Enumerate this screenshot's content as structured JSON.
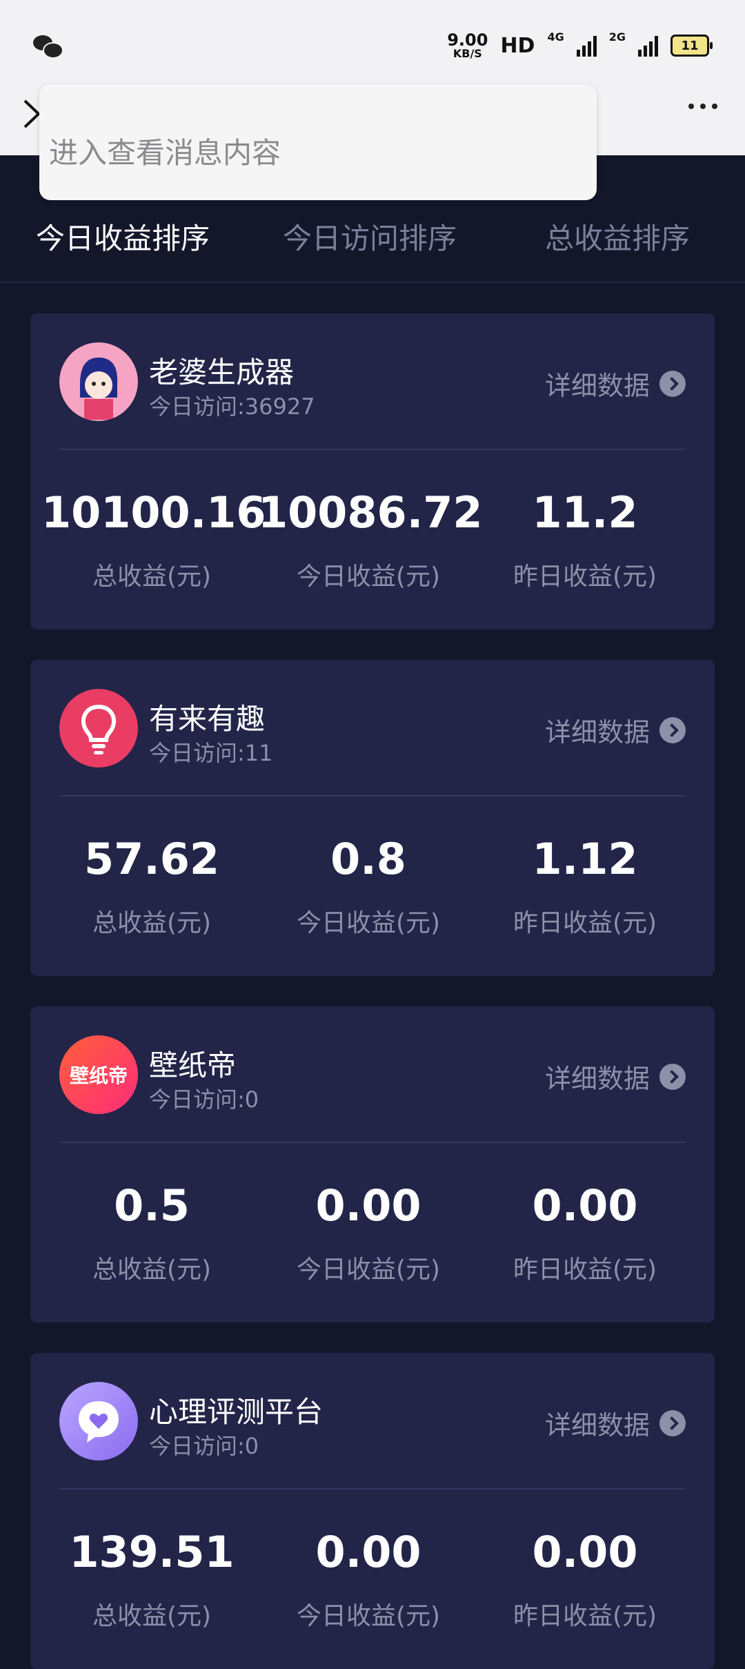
{
  "status_bar": {
    "speed": "9.00",
    "speed_unit": "KB/S",
    "hd": "HD",
    "net1": "4G",
    "net2": "2G",
    "battery": "11"
  },
  "toast": {
    "text": "进入查看消息内容"
  },
  "tabs": [
    {
      "label": "今日收益排序",
      "active": true
    },
    {
      "label": "今日访问排序",
      "active": false
    },
    {
      "label": "总收益排序",
      "active": false
    }
  ],
  "detail_label": "详细数据",
  "cards": [
    {
      "name": "老婆生成器",
      "visits": "今日访问:36927",
      "logo": "girl-avatar-icon",
      "stats": [
        {
          "value": "10100.16",
          "label": "总收益(元)"
        },
        {
          "value": "10086.72",
          "label": "今日收益(元)"
        },
        {
          "value": "11.2",
          "label": "昨日收益(元)"
        }
      ]
    },
    {
      "name": "有来有趣",
      "visits": "今日访问:11",
      "logo": "lightbulb-icon",
      "stats": [
        {
          "value": "57.62",
          "label": "总收益(元)"
        },
        {
          "value": "0.8",
          "label": "今日收益(元)"
        },
        {
          "value": "1.12",
          "label": "昨日收益(元)"
        }
      ]
    },
    {
      "name": "壁纸帝",
      "visits": "今日访问:0",
      "logo": "wallpaper-logo",
      "logo_text": "壁纸帝",
      "stats": [
        {
          "value": "0.5",
          "label": "总收益(元)"
        },
        {
          "value": "0.00",
          "label": "今日收益(元)"
        },
        {
          "value": "0.00",
          "label": "昨日收益(元)"
        }
      ]
    },
    {
      "name": "心理评测平台",
      "visits": "今日访问:0",
      "logo": "heart-chat-icon",
      "stats": [
        {
          "value": "139.51",
          "label": "总收益(元)"
        },
        {
          "value": "0.00",
          "label": "今日收益(元)"
        },
        {
          "value": "0.00",
          "label": "昨日收益(元)"
        }
      ]
    }
  ],
  "colors": {
    "background": "#14162a",
    "card": "#222548",
    "muted": "#8d90a9"
  }
}
